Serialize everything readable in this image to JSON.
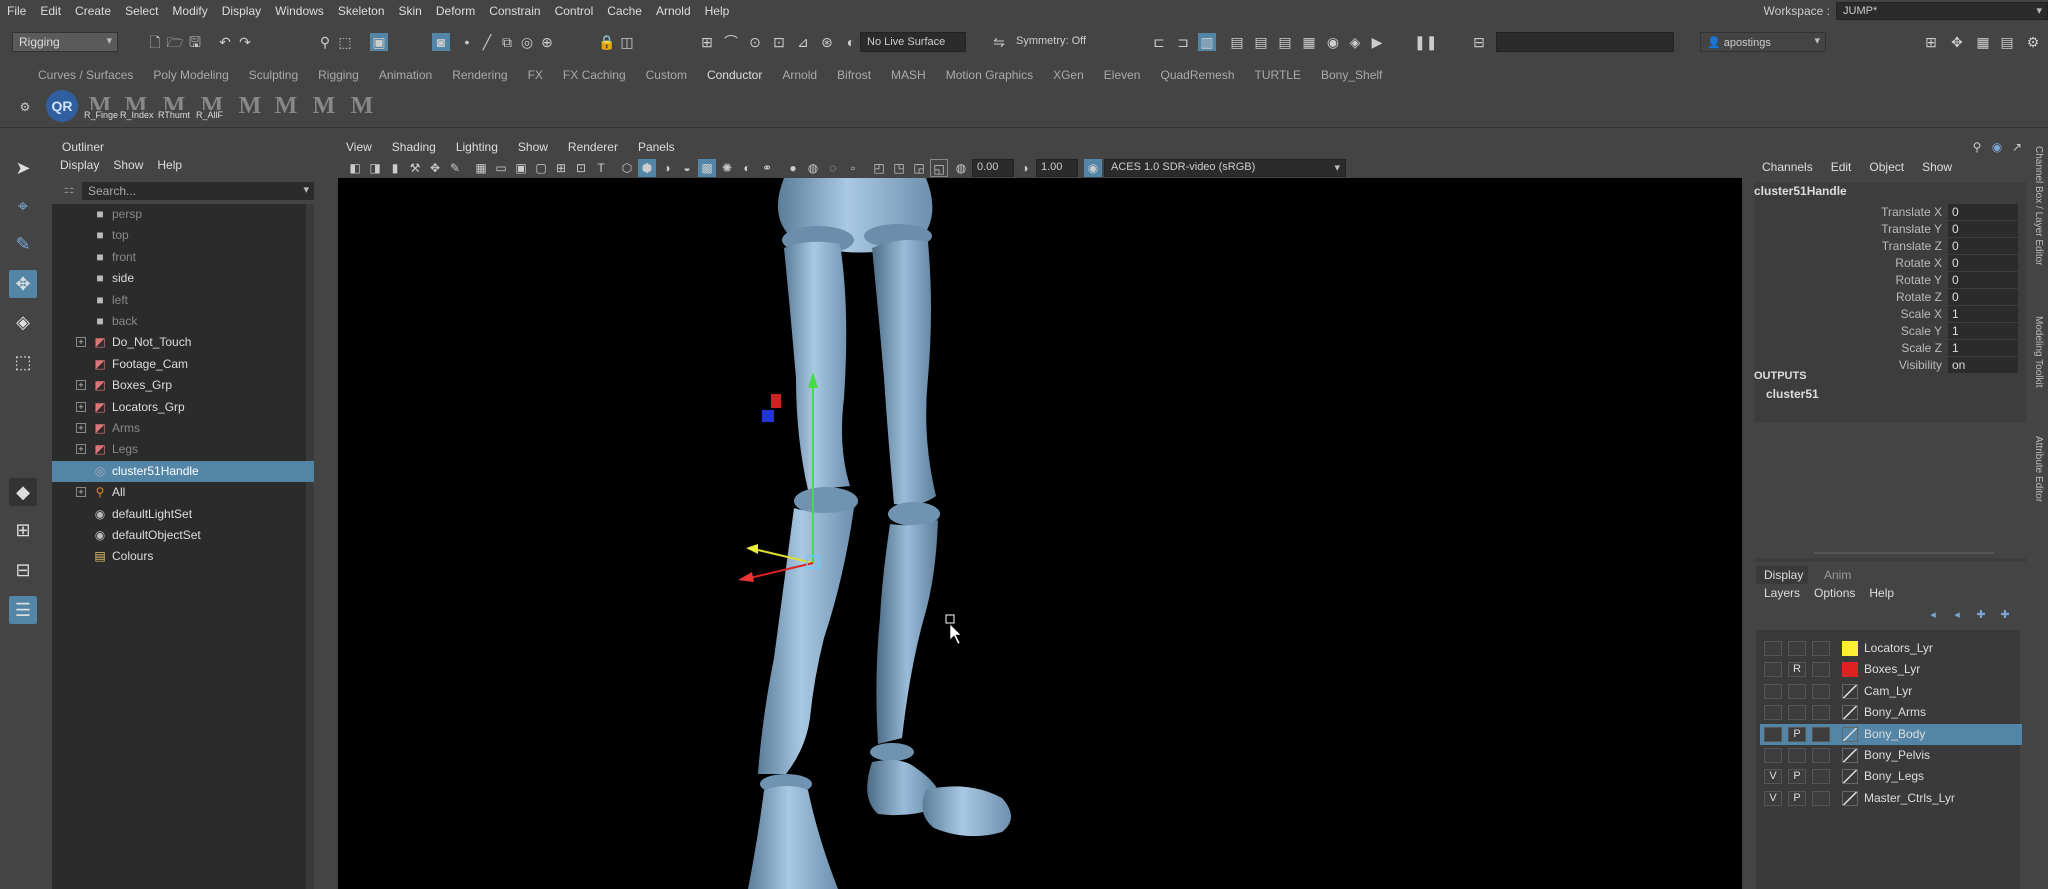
{
  "menubar": {
    "items": [
      "File",
      "Edit",
      "Create",
      "Select",
      "Modify",
      "Display",
      "Windows",
      "Skeleton",
      "Skin",
      "Deform",
      "Constrain",
      "Control",
      "Cache",
      "Arnold",
      "Help"
    ],
    "workspace_label": "Workspace :",
    "workspace_value": "JUMP*"
  },
  "statusline": {
    "menuset": "Rigging",
    "live_surface": "No Live Surface",
    "symmetry": "Symmetry: Off",
    "user": "apostings"
  },
  "shelf": {
    "tabs": [
      "Curves / Surfaces",
      "Poly Modeling",
      "Sculpting",
      "Rigging",
      "Animation",
      "Rendering",
      "FX",
      "FX Caching",
      "Custom",
      "Conductor",
      "Arnold",
      "Bifrost",
      "MASH",
      "Motion Graphics",
      "XGen",
      "Eleven",
      "QuadRemesh",
      "TURTLE",
      "Bony_Shelf"
    ],
    "active_tab": "Conductor",
    "qr_label": "QR",
    "icon_glyph": "M",
    "button_labels": [
      "R_Finge",
      "R_Index",
      "RThumt",
      "R_AllF"
    ]
  },
  "outliner": {
    "title": "Outliner",
    "menu": [
      "Display",
      "Show",
      "Help"
    ],
    "search_placeholder": "Search...",
    "rows": [
      {
        "label": "persp",
        "icon": "camera-icon",
        "dim": true,
        "expand": false
      },
      {
        "label": "top",
        "icon": "camera-icon",
        "dim": true,
        "expand": false
      },
      {
        "label": "front",
        "icon": "camera-icon",
        "dim": true,
        "expand": false
      },
      {
        "label": "side",
        "icon": "camera-icon",
        "dim": false,
        "expand": false
      },
      {
        "label": "left",
        "icon": "camera-icon",
        "dim": true,
        "expand": false
      },
      {
        "label": "back",
        "icon": "camera-icon",
        "dim": true,
        "expand": false
      },
      {
        "label": "Do_Not_Touch",
        "icon": "group-icon",
        "dim": false,
        "expand": true
      },
      {
        "label": "Footage_Cam",
        "icon": "group-icon",
        "dim": false,
        "expand": false
      },
      {
        "label": "Boxes_Grp",
        "icon": "group-icon",
        "dim": false,
        "expand": true
      },
      {
        "label": "Locators_Grp",
        "icon": "group-icon",
        "dim": false,
        "expand": true
      },
      {
        "label": "Arms",
        "icon": "group-icon",
        "dim": true,
        "expand": true
      },
      {
        "label": "Legs",
        "icon": "group-icon",
        "dim": true,
        "expand": true
      },
      {
        "label": "cluster51Handle",
        "icon": "cluster-icon",
        "dim": false,
        "expand": false,
        "selected": true
      },
      {
        "label": "All",
        "icon": "joint-icon",
        "dim": false,
        "expand": true
      },
      {
        "label": "defaultLightSet",
        "icon": "set-icon",
        "dim": false,
        "expand": false
      },
      {
        "label": "defaultObjectSet",
        "icon": "set-icon",
        "dim": false,
        "expand": false
      },
      {
        "label": "Colours",
        "icon": "folder-icon",
        "dim": false,
        "expand": false
      }
    ]
  },
  "viewport": {
    "menu": [
      "View",
      "Shading",
      "Lighting",
      "Show",
      "Renderer",
      "Panels"
    ],
    "exposure": "0.00",
    "gamma": "1.00",
    "color_space": "ACES 1.0 SDR-video (sRGB)"
  },
  "channelbox": {
    "menu": [
      "Channels",
      "Edit",
      "Object",
      "Show"
    ],
    "object_name": "cluster51Handle",
    "attributes": [
      {
        "name": "Translate X",
        "value": "0"
      },
      {
        "name": "Translate Y",
        "value": "0"
      },
      {
        "name": "Translate Z",
        "value": "0"
      },
      {
        "name": "Rotate X",
        "value": "0"
      },
      {
        "name": "Rotate Y",
        "value": "0"
      },
      {
        "name": "Rotate Z",
        "value": "0"
      },
      {
        "name": "Scale X",
        "value": "1"
      },
      {
        "name": "Scale Y",
        "value": "1"
      },
      {
        "name": "Scale Z",
        "value": "1"
      },
      {
        "name": "Visibility",
        "value": "on"
      }
    ],
    "outputs_label": "OUTPUTS",
    "outputs_item": "cluster51"
  },
  "layers": {
    "tabs": [
      "Display",
      "Anim"
    ],
    "menu": [
      "Layers",
      "Options",
      "Help"
    ],
    "rows": [
      {
        "v": "",
        "p": "",
        "name": "Locators_Lyr",
        "color": "#ffee33"
      },
      {
        "v": "",
        "p": "R",
        "name": "Boxes_Lyr",
        "color": "#dd2222"
      },
      {
        "v": "",
        "p": "",
        "name": "Cam_Lyr",
        "color": ""
      },
      {
        "v": "",
        "p": "",
        "name": "Bony_Arms",
        "color": ""
      },
      {
        "v": "",
        "p": "P",
        "name": "Bony_Body",
        "color": "",
        "selected": true
      },
      {
        "v": "",
        "p": "",
        "name": "Bony_Pelvis",
        "color": ""
      },
      {
        "v": "V",
        "p": "P",
        "name": "Bony_Legs",
        "color": ""
      },
      {
        "v": "V",
        "p": "P",
        "name": "Master_Ctrls_Lyr",
        "color": ""
      }
    ]
  },
  "side_tabs": [
    "Channel Box / Layer Editor",
    "Modeling Toolkit",
    "Attribute Editor"
  ]
}
